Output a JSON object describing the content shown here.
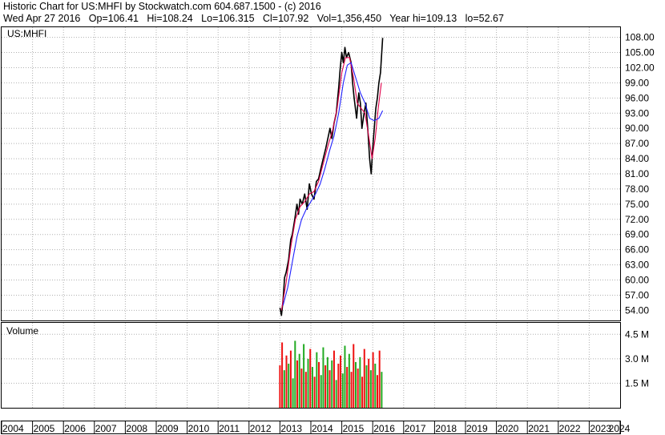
{
  "header": {
    "line1": "Historic Chart for US:MHFI by Stockwatch.com 604.687.1500 - (c) 2016",
    "line2": "Wed Apr 27 2016   Op=106.41   Hi=108.24   Lo=106.315   Cl=107.92   Vol=1,356,450   Year hi=109.13   lo=52.67"
  },
  "chart_data": [
    {
      "type": "line",
      "panel": "price",
      "symbol_label": "US:MHFI",
      "x_unit": "year",
      "xlim": [
        2004,
        2024
      ],
      "ylim": [
        52.0,
        110.0
      ],
      "y_ticks": [
        "108.00",
        "105.00",
        "102.00",
        "99.00",
        "96.00",
        "93.00",
        "90.00",
        "87.00",
        "84.00",
        "81.00",
        "78.00",
        "75.00",
        "72.00",
        "69.00",
        "66.00",
        "63.00",
        "60.00",
        "57.00",
        "54.00"
      ],
      "x_ticks": [
        "2004",
        "2005",
        "2006",
        "2007",
        "2008",
        "2009",
        "2010",
        "2011",
        "2012",
        "2013",
        "2014",
        "2015",
        "2016",
        "2017",
        "2018",
        "2019",
        "2020",
        "2021",
        "2022",
        "2023",
        "2024"
      ],
      "series": [
        {
          "role": "price",
          "color": "#000000",
          "points": [
            [
              2013.0,
              54.5
            ],
            [
              2013.05,
              53.0
            ],
            [
              2013.1,
              56.0
            ],
            [
              2013.15,
              60.5
            ],
            [
              2013.2,
              61.5
            ],
            [
              2013.28,
              64.0
            ],
            [
              2013.35,
              68.0
            ],
            [
              2013.4,
              69.0
            ],
            [
              2013.48,
              72.0
            ],
            [
              2013.55,
              75.0
            ],
            [
              2013.6,
              73.0
            ],
            [
              2013.65,
              76.0
            ],
            [
              2013.72,
              75.0
            ],
            [
              2013.8,
              77.0
            ],
            [
              2013.88,
              74.0
            ],
            [
              2013.95,
              79.0
            ],
            [
              2014.02,
              77.0
            ],
            [
              2014.1,
              76.0
            ],
            [
              2014.18,
              79.5
            ],
            [
              2014.25,
              80.0
            ],
            [
              2014.32,
              82.0
            ],
            [
              2014.4,
              84.0
            ],
            [
              2014.48,
              86.0
            ],
            [
              2014.55,
              88.0
            ],
            [
              2014.62,
              90.0
            ],
            [
              2014.68,
              88.0
            ],
            [
              2014.75,
              91.0
            ],
            [
              2014.82,
              93.0
            ],
            [
              2014.9,
              98.0
            ],
            [
              2014.95,
              102.0
            ],
            [
              2015.0,
              105.0
            ],
            [
              2015.05,
              103.0
            ],
            [
              2015.1,
              106.0
            ],
            [
              2015.15,
              104.0
            ],
            [
              2015.22,
              105.0
            ],
            [
              2015.3,
              103.0
            ],
            [
              2015.35,
              99.0
            ],
            [
              2015.4,
              96.0
            ],
            [
              2015.48,
              92.0
            ],
            [
              2015.55,
              97.0
            ],
            [
              2015.6,
              95.0
            ],
            [
              2015.65,
              90.0
            ],
            [
              2015.72,
              93.0
            ],
            [
              2015.78,
              95.0
            ],
            [
              2015.85,
              89.0
            ],
            [
              2015.9,
              84.0
            ],
            [
              2015.95,
              81.0
            ],
            [
              2016.0,
              86.0
            ],
            [
              2016.05,
              90.0
            ],
            [
              2016.1,
              94.0
            ],
            [
              2016.15,
              96.0
            ],
            [
              2016.2,
              99.0
            ],
            [
              2016.25,
              101.0
            ],
            [
              2016.32,
              107.9
            ]
          ]
        },
        {
          "role": "moving-average-short",
          "color": "#e0004a",
          "points": [
            [
              2013.05,
              54.0
            ],
            [
              2013.2,
              59.5
            ],
            [
              2013.35,
              66.5
            ],
            [
              2013.5,
              72.0
            ],
            [
              2013.65,
              74.5
            ],
            [
              2013.8,
              75.5
            ],
            [
              2013.95,
              77.0
            ],
            [
              2014.1,
              77.5
            ],
            [
              2014.25,
              79.5
            ],
            [
              2014.4,
              83.0
            ],
            [
              2014.55,
              86.5
            ],
            [
              2014.7,
              89.5
            ],
            [
              2014.85,
              94.0
            ],
            [
              2015.0,
              101.0
            ],
            [
              2015.12,
              104.0
            ],
            [
              2015.25,
              104.0
            ],
            [
              2015.38,
              100.0
            ],
            [
              2015.5,
              95.0
            ],
            [
              2015.62,
              94.0
            ],
            [
              2015.75,
              93.0
            ],
            [
              2015.88,
              88.0
            ],
            [
              2015.98,
              84.0
            ],
            [
              2016.08,
              88.0
            ],
            [
              2016.18,
              94.0
            ],
            [
              2016.28,
              99.0
            ]
          ]
        },
        {
          "role": "moving-average-long",
          "color": "#2020ff",
          "points": [
            [
              2013.1,
              55.0
            ],
            [
              2013.25,
              58.5
            ],
            [
              2013.4,
              63.5
            ],
            [
              2013.55,
              68.5
            ],
            [
              2013.7,
              72.0
            ],
            [
              2013.85,
              74.0
            ],
            [
              2014.0,
              75.5
            ],
            [
              2014.15,
              77.0
            ],
            [
              2014.3,
              79.0
            ],
            [
              2014.45,
              82.0
            ],
            [
              2014.6,
              85.5
            ],
            [
              2014.75,
              88.5
            ],
            [
              2014.9,
              93.0
            ],
            [
              2015.05,
              99.0
            ],
            [
              2015.18,
              102.5
            ],
            [
              2015.3,
              103.0
            ],
            [
              2015.45,
              100.0
            ],
            [
              2015.6,
              97.0
            ],
            [
              2015.75,
              95.0
            ],
            [
              2015.9,
              92.0
            ],
            [
              2016.05,
              91.5
            ],
            [
              2016.2,
              92.0
            ],
            [
              2016.32,
              93.5
            ]
          ]
        }
      ]
    },
    {
      "type": "bar",
      "panel": "volume",
      "title": "Volume",
      "xlim": [
        2004,
        2024
      ],
      "ylim": [
        0,
        5.2
      ],
      "y_ticks": [
        "4.5 M",
        "3.0 M",
        "1.5 M"
      ],
      "colors": {
        "up": "#22aa22",
        "down": "#ee1111"
      },
      "x": [
        2013.0,
        2013.07,
        2013.14,
        2013.21,
        2013.28,
        2013.35,
        2013.42,
        2013.49,
        2013.56,
        2013.63,
        2013.7,
        2013.77,
        2013.84,
        2013.91,
        2013.98,
        2014.05,
        2014.12,
        2014.19,
        2014.26,
        2014.33,
        2014.4,
        2014.47,
        2014.54,
        2014.61,
        2014.68,
        2014.75,
        2014.82,
        2014.89,
        2014.96,
        2015.03,
        2015.1,
        2015.17,
        2015.24,
        2015.31,
        2015.38,
        2015.45,
        2015.52,
        2015.59,
        2015.66,
        2015.73,
        2015.8,
        2015.87,
        2015.94,
        2016.01,
        2016.08,
        2016.15,
        2016.22,
        2016.29
      ],
      "values": [
        2.6,
        4.0,
        2.3,
        3.2,
        2.7,
        3.5,
        1.8,
        4.1,
        2.9,
        3.3,
        2.4,
        3.9,
        2.2,
        3.0,
        3.6,
        2.5,
        1.9,
        3.4,
        2.8,
        2.0,
        3.7,
        2.6,
        3.1,
        2.3,
        2.9,
        3.5,
        1.7,
        2.7,
        3.2,
        2.1,
        3.8,
        2.5,
        3.3,
        2.2,
        3.9,
        2.8,
        2.4,
        3.1,
        1.9,
        3.6,
        2.6,
        3.0,
        2.3,
        3.4,
        2.7,
        2.0,
        3.5,
        2.2
      ],
      "direction": [
        "down",
        "down",
        "up",
        "down",
        "up",
        "down",
        "up",
        "up",
        "down",
        "up",
        "down",
        "up",
        "down",
        "up",
        "down",
        "up",
        "down",
        "up",
        "down",
        "up",
        "up",
        "down",
        "up",
        "down",
        "up",
        "down",
        "up",
        "down",
        "down",
        "up",
        "up",
        "down",
        "up",
        "down",
        "down",
        "up",
        "down",
        "up",
        "down",
        "down",
        "up",
        "down",
        "up",
        "down",
        "up",
        "down",
        "down",
        "up"
      ]
    }
  ]
}
